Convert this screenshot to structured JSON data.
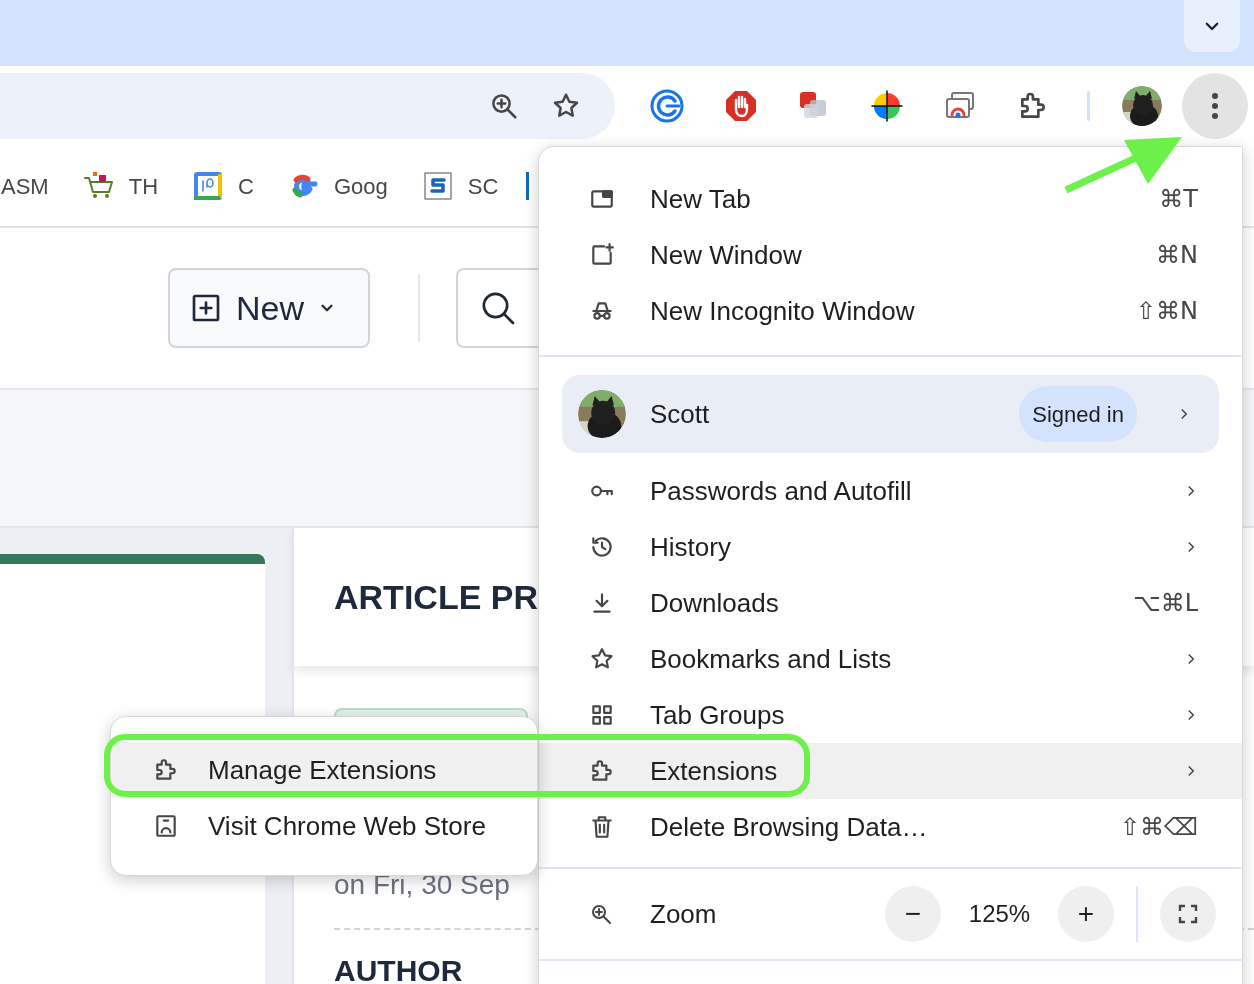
{
  "bookmarks": [
    {
      "label": "ASM"
    },
    {
      "label": "TH"
    },
    {
      "label": "C"
    },
    {
      "label": "Goog"
    },
    {
      "label": "SC"
    }
  ],
  "page": {
    "new_button": "New",
    "heading": "ARTICLE PR",
    "date_text": "on Fri, 30 Sep",
    "section_label": "AUTHOR"
  },
  "menu": {
    "items": [
      {
        "kind": "item",
        "label": "New Tab",
        "shortcut": "⌘T",
        "submenu": false,
        "selected": false
      },
      {
        "kind": "item",
        "label": "New Window",
        "shortcut": "⌘N",
        "submenu": false,
        "selected": false
      },
      {
        "kind": "item",
        "label": "New Incognito Window",
        "shortcut": "⇧⌘N",
        "submenu": false,
        "selected": false
      },
      {
        "kind": "divider"
      },
      {
        "kind": "profile",
        "label": "Scott",
        "badge": "Signed in",
        "submenu": true
      },
      {
        "kind": "item",
        "label": "Passwords and Autofill",
        "submenu": true,
        "selected": false
      },
      {
        "kind": "item",
        "label": "History",
        "submenu": true,
        "selected": false
      },
      {
        "kind": "item",
        "label": "Downloads",
        "shortcut": "⌥⌘L",
        "submenu": false,
        "selected": false
      },
      {
        "kind": "item",
        "label": "Bookmarks and Lists",
        "submenu": true,
        "selected": false
      },
      {
        "kind": "item",
        "label": "Tab Groups",
        "submenu": true,
        "selected": false
      },
      {
        "kind": "item",
        "label": "Extensions",
        "submenu": true,
        "selected": true
      },
      {
        "kind": "item",
        "label": "Delete Browsing Data…",
        "shortcut": "⇧⌘⌫",
        "submenu": false,
        "selected": false
      },
      {
        "kind": "divider"
      },
      {
        "kind": "zoom",
        "label": "Zoom",
        "minus": "−",
        "value": "125%",
        "plus": "+"
      },
      {
        "kind": "divider"
      }
    ]
  },
  "submenu": {
    "items": [
      {
        "label": "Manage Extensions",
        "selected": true
      },
      {
        "label": "Visit Chrome Web Store",
        "selected": false
      }
    ]
  }
}
